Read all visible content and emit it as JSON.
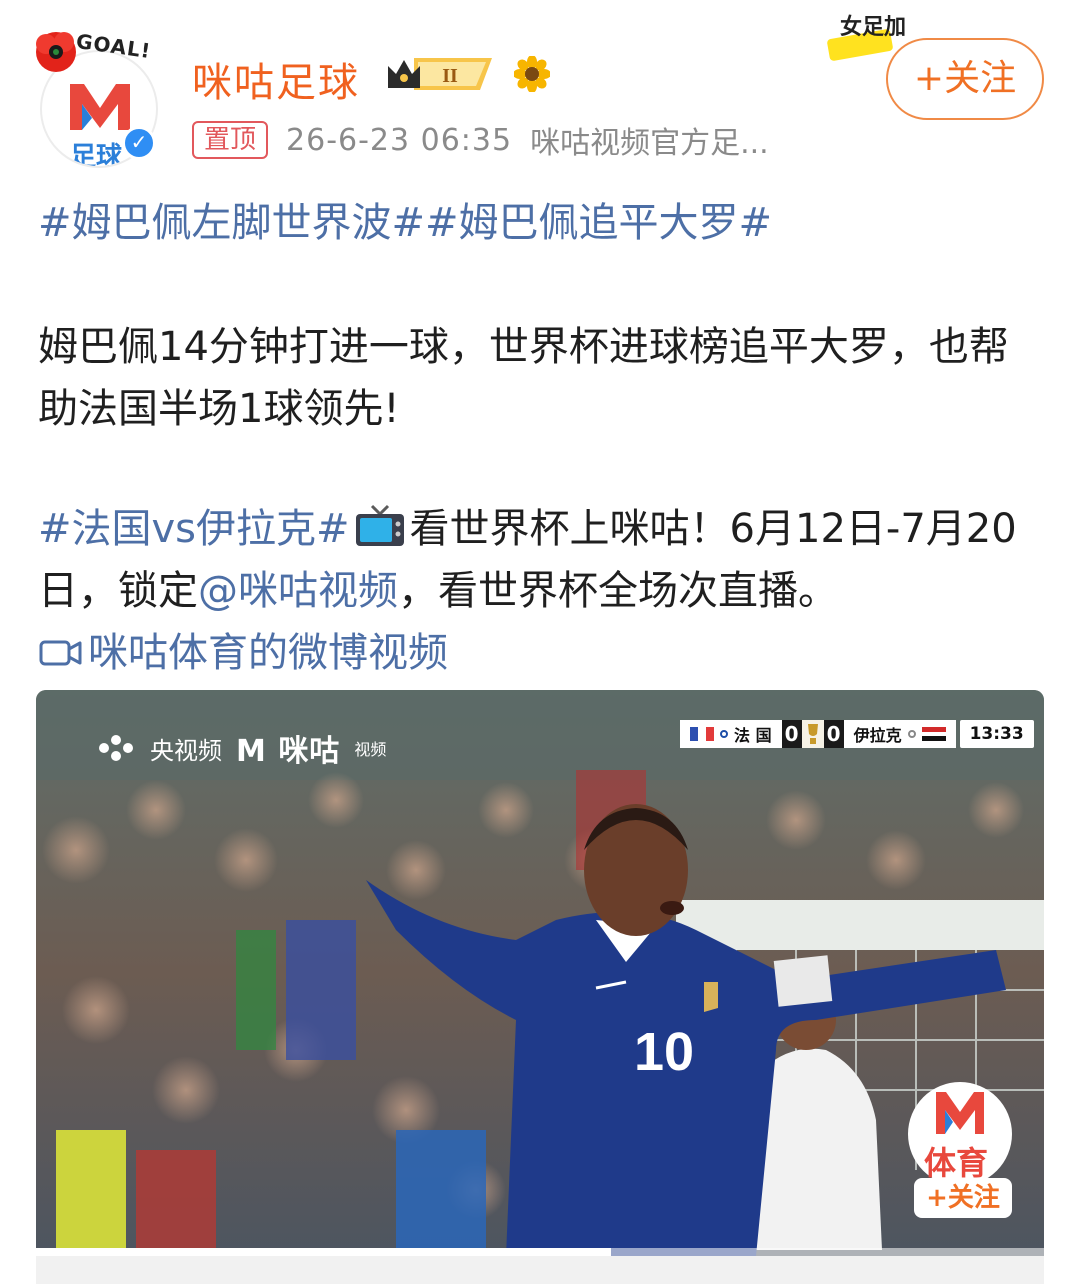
{
  "account": {
    "name": "咪咕足球",
    "avatar_badge_text": "GOAL!",
    "avatar_sub_text": "足球",
    "vip_level": "II",
    "pin_label": "置顶",
    "timestamp": "26-6-23 06:35",
    "source": "咪咕视频官方足...",
    "follow_label": "+关注",
    "promo_text": "女足加"
  },
  "post": {
    "hashtags_line": [
      "#姆巴佩左脚世界波#",
      "#姆巴佩追平大罗#"
    ],
    "paragraph_1": "姆巴佩14分钟打进一球，世界杯进球榜追平大罗，也帮助法国半场1球领先!",
    "hashtag_match": "#法国vs伊拉克#",
    "paragraph_2_a": "看世界杯上咪咕！6月12日-7月20日，锁定",
    "mention": "@咪咕视频",
    "paragraph_2_b": "，看世界杯全场次直播。",
    "video_link_label": "咪咕体育的微博视频"
  },
  "video": {
    "broadcaster_1": "央视频",
    "broadcaster_2": "咪咕",
    "broadcaster_2_sub": "视频",
    "team_home": "法 国",
    "team_away": "伊拉克",
    "score_home": "0",
    "score_away": "0",
    "match_clock": "13:33",
    "jersey_number": "10",
    "corner_logo_text": "体育",
    "corner_follow_label": "+关注",
    "progress_fraction": 0.57
  },
  "colors": {
    "name": "#f0611f",
    "hashtag": "#4d6fa6",
    "follow": "#f07024",
    "pin": "#e2585c",
    "meta": "#8a8a8a"
  },
  "icons": [
    "poppy-flower-icon",
    "verified-icon",
    "crown-vip-icon",
    "sunflower-icon",
    "tv-icon",
    "video-camera-icon",
    "trophy-icon"
  ]
}
